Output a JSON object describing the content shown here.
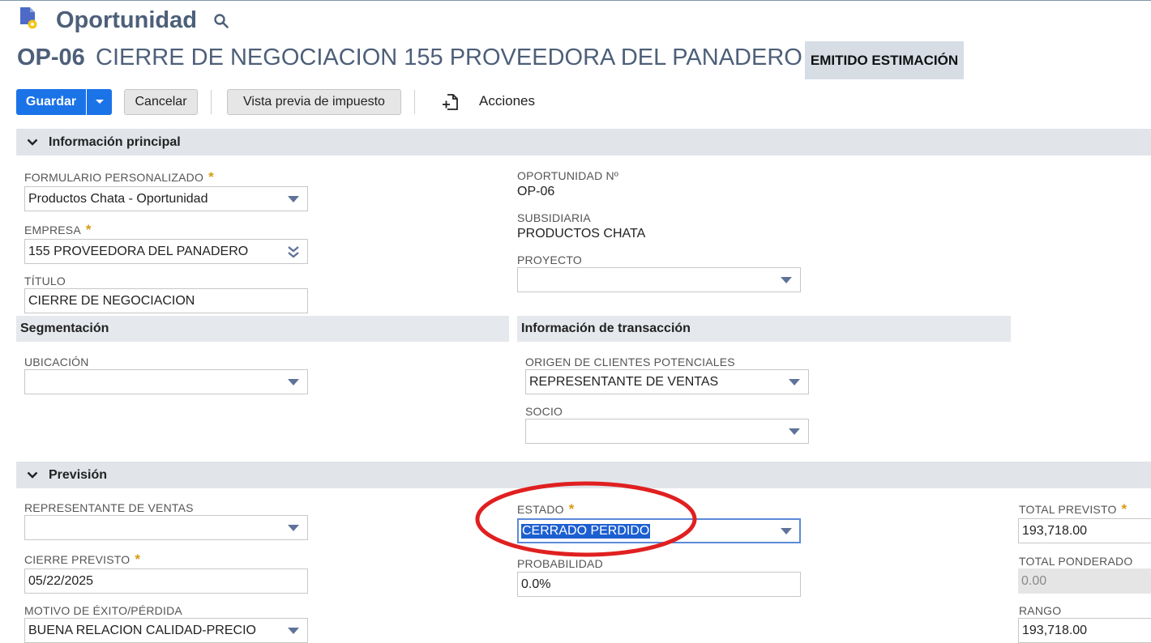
{
  "header": {
    "record_type": "Oportunidad",
    "transaction_number": "OP-06",
    "transaction_name": "CIERRE DE NEGOCIACION 155 PROVEEDORA DEL PANADERO",
    "status": "EMITIDO ESTIMACIÓN"
  },
  "toolbar": {
    "save_label": "Guardar",
    "cancel_label": "Cancelar",
    "tax_preview_label": "Vista previa de impuesto",
    "actions_label": "Acciones"
  },
  "sections": {
    "main_info": "Información principal",
    "segmentation": "Segmentación",
    "transaction_info": "Información de transacción",
    "forecast": "Previsión"
  },
  "main_info": {
    "custom_form": {
      "label": "FORMULARIO PERSONALIZADO",
      "value": "Productos Chata - Oportunidad"
    },
    "company": {
      "label": "EMPRESA",
      "value": "155 PROVEEDORA DEL PANADERO"
    },
    "title": {
      "label": "TÍTULO",
      "value": "CIERRE DE NEGOCIACION"
    },
    "opportunity_number": {
      "label": "OPORTUNIDAD Nº",
      "value": "OP-06"
    },
    "subsidiary": {
      "label": "SUBSIDIARIA",
      "value": "PRODUCTOS CHATA"
    },
    "project": {
      "label": "PROYECTO",
      "value": ""
    },
    "required_mark": "*"
  },
  "segmentation": {
    "location": {
      "label": "UBICACIÓN",
      "value": ""
    }
  },
  "transaction_info": {
    "lead_source": {
      "label": "ORIGEN DE CLIENTES POTENCIALES",
      "value": "REPRESENTANTE DE VENTAS"
    },
    "partner": {
      "label": "SOCIO",
      "value": ""
    }
  },
  "forecast": {
    "sales_rep": {
      "label": "REPRESENTANTE DE VENTAS",
      "value": ""
    },
    "expected_close": {
      "label": "CIERRE PREVISTO",
      "value": "05/22/2025"
    },
    "win_loss_reason": {
      "label": "MOTIVO DE ÉXITO/PÉRDIDA",
      "value": "BUENA RELACION CALIDAD-PRECIO"
    },
    "status": {
      "label": "ESTADO",
      "value": "CERRADO PERDIDO"
    },
    "probability": {
      "label": "PROBABILIDAD",
      "value": "0.0%"
    },
    "projected_total": {
      "label": "TOTAL PREVISTO",
      "value": "193,718.00"
    },
    "weighted_total": {
      "label": "TOTAL PONDERADO",
      "value": "0.00"
    },
    "range": {
      "label": "RANGO",
      "value": "193,718.00"
    }
  },
  "icons": {
    "record": "document-gear-icon",
    "search": "search-icon",
    "actions": "document-add-icon",
    "dropdown": "caret-down-icon",
    "multiselect": "double-chevron-down-icon"
  },
  "colors": {
    "primary": "#1b73e8",
    "title": "#4d5f79",
    "required": "#d99b10",
    "annotation": "#e02020"
  }
}
